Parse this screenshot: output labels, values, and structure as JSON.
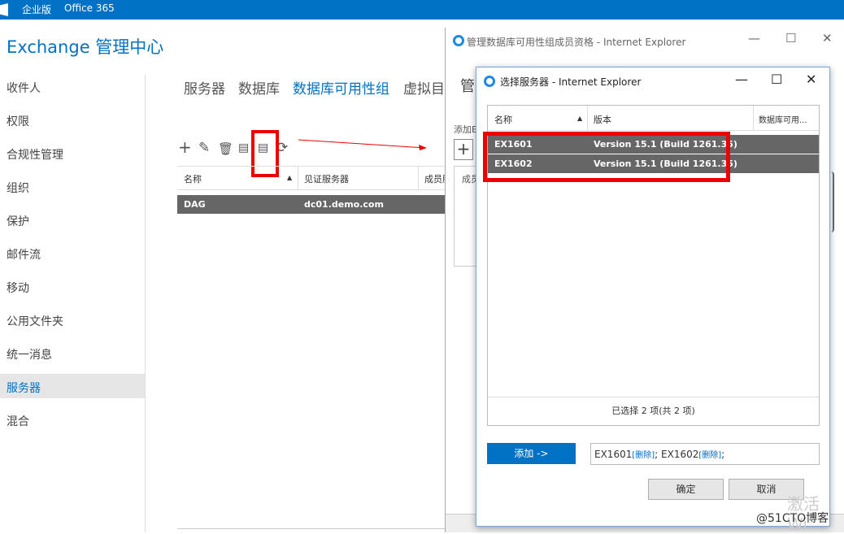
{
  "topbar": {
    "edition": "企业版",
    "product": "Office 365"
  },
  "app": {
    "title": "Exchange 管理中心"
  },
  "nav": {
    "items": [
      "收件人",
      "权限",
      "合规性管理",
      "组织",
      "保护",
      "邮件流",
      "移动",
      "公用文件夹",
      "统一消息",
      "服务器",
      "混合"
    ],
    "selected": "服务器"
  },
  "tabs": [
    "服务器",
    "数据库",
    "数据库可用性组",
    "虚拟目"
  ],
  "selected_tab": "数据库可用性组",
  "toolbar": {
    "icons": [
      "plus-icon",
      "edit-icon",
      "delete-icon",
      "add-member-icon",
      "manage-member-icon",
      "refresh-icon"
    ]
  },
  "dag_grid": {
    "headers": [
      "名称",
      "见证服务器",
      "成员服"
    ],
    "rows": [
      {
        "name": "DAG",
        "witness": "dc01.demo.com"
      }
    ]
  },
  "ie_window": {
    "title": "管理数据库可用性组成员资格 - Internet Explorer",
    "heading": "管",
    "add_label": "添加E",
    "member_label": "成员",
    "plus": "+"
  },
  "dialog": {
    "title": "选择服务器 - Internet Explorer",
    "headers": [
      "名称",
      "版本",
      "数据库可用..."
    ],
    "rows": [
      {
        "name": "EX1601",
        "version": "Version 15.1 (Build 1261.35)"
      },
      {
        "name": "EX1602",
        "version": "Version 15.1 (Build 1261.35)"
      }
    ],
    "footer": "已选择 2 项(共 2 项)",
    "add_button": "添加 ->",
    "selected_field": {
      "item1": "EX1601",
      "remove": "[删除]",
      "sep": "; ",
      "item2": "EX1602",
      "end": ";"
    },
    "ok_button": "确定",
    "cancel_button": "取消"
  },
  "window_controls": {
    "minimize": "—",
    "maximize": "☐",
    "close": "✕"
  },
  "watermark": {
    "text": "@51CTO博客",
    "faint": "激活 Wi"
  }
}
